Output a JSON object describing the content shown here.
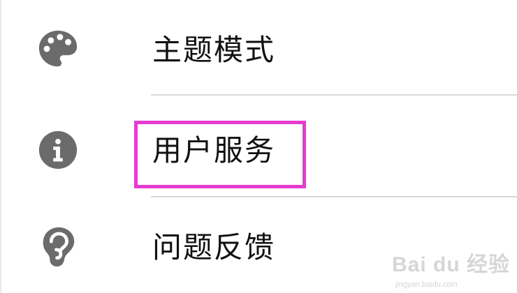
{
  "menu": {
    "items": [
      {
        "label": "主题模式",
        "icon": "palette-icon"
      },
      {
        "label": "用户服务",
        "icon": "info-icon"
      },
      {
        "label": "问题反馈",
        "icon": "ear-icon"
      }
    ]
  },
  "highlight": {
    "color": "#e63bd0",
    "target": "用户服务"
  },
  "watermark": {
    "brand": "Bai du 经验",
    "url": "jingyan.baidu.com"
  },
  "colors": {
    "icon": "#6b6b6b",
    "text": "#111111",
    "divider": "#d9d9d9"
  }
}
